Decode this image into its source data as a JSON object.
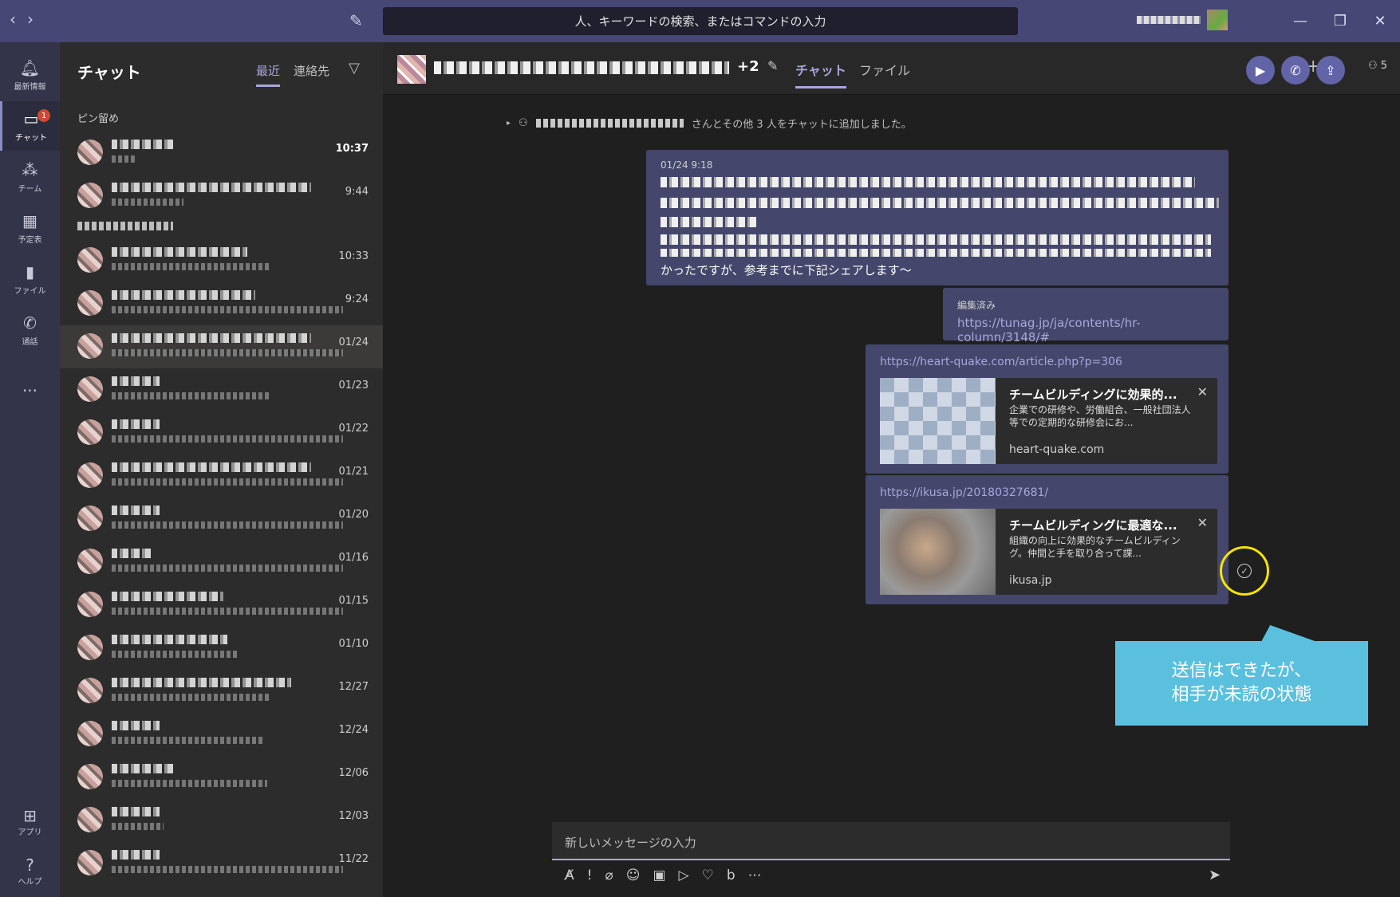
{
  "search": {
    "placeholder": "人、キーワードの検索、またはコマンドの入力"
  },
  "rail": {
    "items": [
      {
        "label": "最新情報",
        "icon": "bell-icon"
      },
      {
        "label": "チャット",
        "icon": "chat-icon",
        "badge": "1"
      },
      {
        "label": "チーム",
        "icon": "teams-icon"
      },
      {
        "label": "予定表",
        "icon": "calendar-icon"
      },
      {
        "label": "ファイル",
        "icon": "file-icon"
      },
      {
        "label": "通話",
        "icon": "phone-icon"
      }
    ],
    "more": "...",
    "apps_label": "アプリ",
    "help_label": "ヘルプ"
  },
  "chatlist": {
    "title": "チャット",
    "tab_recent": "最近",
    "tab_contacts": "連絡先",
    "pinned_label": "ピン留め",
    "rows": [
      {
        "time": "10:37"
      },
      {
        "time": "9:44"
      },
      {
        "time": "10:33"
      },
      {
        "time": "9:24"
      },
      {
        "time": "01/24"
      },
      {
        "time": "01/23"
      },
      {
        "time": "01/22"
      },
      {
        "time": "01/21"
      },
      {
        "time": "01/20"
      },
      {
        "time": "01/16"
      },
      {
        "time": "01/15"
      },
      {
        "time": "01/10"
      },
      {
        "time": "12/27"
      },
      {
        "time": "12/24"
      },
      {
        "time": "12/06"
      },
      {
        "time": "12/03"
      },
      {
        "time": "11/22"
      }
    ]
  },
  "header": {
    "plus_count": "+2",
    "tab_chat": "チャット",
    "tab_files": "ファイル",
    "people_count": "5"
  },
  "system_message": {
    "text": "さんとその他 3 人をチャットに追加しました。"
  },
  "messages": {
    "m1_time": "01/24 9:18",
    "m1_last_line": "かったですが、参考までに下記シェアします～",
    "m2_edited": "編集済み",
    "m2_link": "https://tunag.jp/ja/contents/hr-column/3148/#",
    "card1": {
      "link": "https://heart-quake.com/article.php?p=306",
      "title": "チームビルディングに効果的...",
      "desc": "企業での研修や、労働組合、一般社団法人等での定期的な研修会にお...",
      "domain": "heart-quake.com"
    },
    "card2": {
      "link": "https://ikusa.jp/20180327681/",
      "title": "チームビルディングに最適な...",
      "desc": "組織の向上に効果的なチームビルディング。仲間と手を取り合って課...",
      "domain": "ikusa.jp"
    }
  },
  "callout": {
    "line1": "送信はできたが、",
    "line2": "相手が未読の状態"
  },
  "compose": {
    "placeholder": "新しいメッセージの入力"
  }
}
